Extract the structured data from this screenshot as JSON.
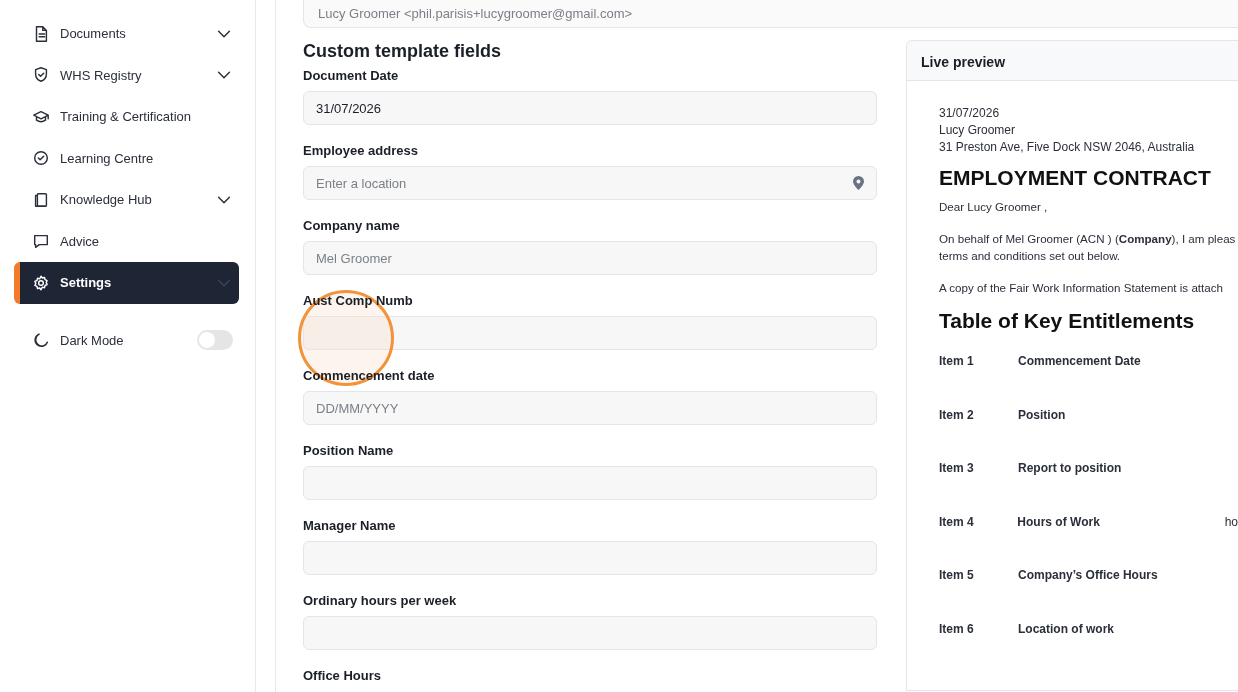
{
  "sidebar": {
    "items": [
      {
        "label": "Documents",
        "expandable": true,
        "selected": false
      },
      {
        "label": "WHS Registry",
        "expandable": true,
        "selected": false
      },
      {
        "label": "Training & Certification",
        "expandable": false,
        "selected": false
      },
      {
        "label": "Learning Centre",
        "expandable": false,
        "selected": false
      },
      {
        "label": "Knowledge Hub",
        "expandable": true,
        "selected": false
      },
      {
        "label": "Advice",
        "expandable": false,
        "selected": false
      },
      {
        "label": "Settings",
        "expandable": true,
        "selected": true
      }
    ],
    "dark_mode": {
      "label": "Dark Mode",
      "on": false
    }
  },
  "recipient_field": {
    "value": "Lucy Groomer <phil.parisis+lucygroomer@gmail.com>",
    "disabled": true
  },
  "form": {
    "title": "Custom template fields",
    "fields": [
      {
        "label": "Document Date",
        "kind": "text",
        "value": "31/07/2026"
      },
      {
        "label": "Employee address",
        "kind": "location",
        "placeholder": "Enter a location"
      },
      {
        "label": "Company name",
        "kind": "text",
        "placeholder": "Mel Groomer"
      },
      {
        "label": "Aust Comp Numb",
        "kind": "text"
      },
      {
        "label": "Commencement date",
        "kind": "text",
        "placeholder": "DD/MM/YYYY"
      },
      {
        "label": "Position Name",
        "kind": "text"
      },
      {
        "label": "Manager Name",
        "kind": "text"
      },
      {
        "label": "Ordinary hours per week",
        "kind": "text"
      }
    ],
    "trailing_label": "Office Hours"
  },
  "preview": {
    "title": "Live preview",
    "address_lines": [
      "31/07/2026",
      "Lucy Groomer",
      "31 Preston Ave, Five Dock NSW 2046, Australia"
    ],
    "heading": "EMPLOYMENT CONTRACT",
    "paragraphs": [
      {
        "lines": [
          "Dear Lucy Groomer ,"
        ]
      },
      {
        "lines": [
          "On behalf of Mel Groomer (ACN ) (**Company**), I am pleas",
          "terms and conditions set out below."
        ]
      },
      {
        "lines": [
          "A copy of the Fair Work Information Statement is attach"
        ]
      }
    ],
    "subheading": "Table of Key Entitlements",
    "rows": [
      {
        "item": "Item 1",
        "term": "Commencement Date"
      },
      {
        "item": "Item 2",
        "term": "Position"
      },
      {
        "item": "Item 3",
        "term": "Report to position"
      },
      {
        "item": "Item 4",
        "term": "Hours of Work",
        "value": "ho"
      },
      {
        "item": "Item 5",
        "term": "Company’s Office Hours"
      },
      {
        "item": "Item 6",
        "term": "Location of work"
      }
    ]
  }
}
